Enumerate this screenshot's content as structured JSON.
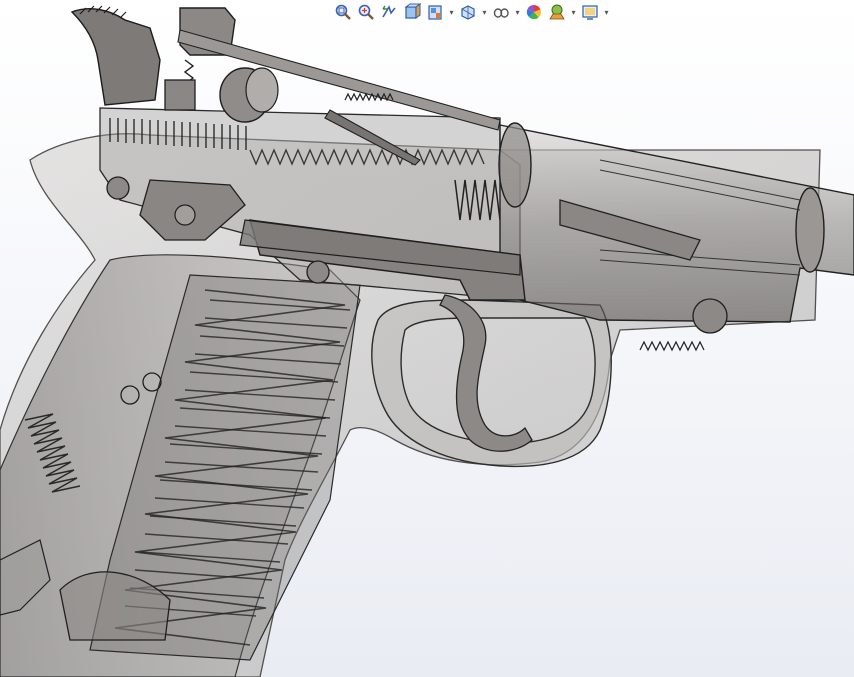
{
  "toolbar": {
    "items": [
      {
        "name": "zoom-to-fit-icon",
        "dropdown": false
      },
      {
        "name": "zoom-to-area-icon",
        "dropdown": false
      },
      {
        "name": "previous-view-icon",
        "dropdown": false
      },
      {
        "name": "section-view-icon",
        "dropdown": false
      },
      {
        "name": "view-orientation-icon",
        "dropdown": true
      },
      {
        "name": "display-style-icon",
        "dropdown": true
      },
      {
        "name": "hide-show-items-icon",
        "dropdown": true
      },
      {
        "name": "edit-appearance-icon",
        "dropdown": false
      },
      {
        "name": "apply-scene-icon",
        "dropdown": true
      },
      {
        "name": "view-settings-icon",
        "dropdown": true
      }
    ]
  },
  "colors": {
    "background_top": "#ffffff",
    "background_bottom": "#e9ecf3",
    "part_fill": "#8a8784",
    "part_edge": "#2b2b2b",
    "transparent_body": "#bcbab8",
    "accent_blue": "#3d6fd8"
  }
}
